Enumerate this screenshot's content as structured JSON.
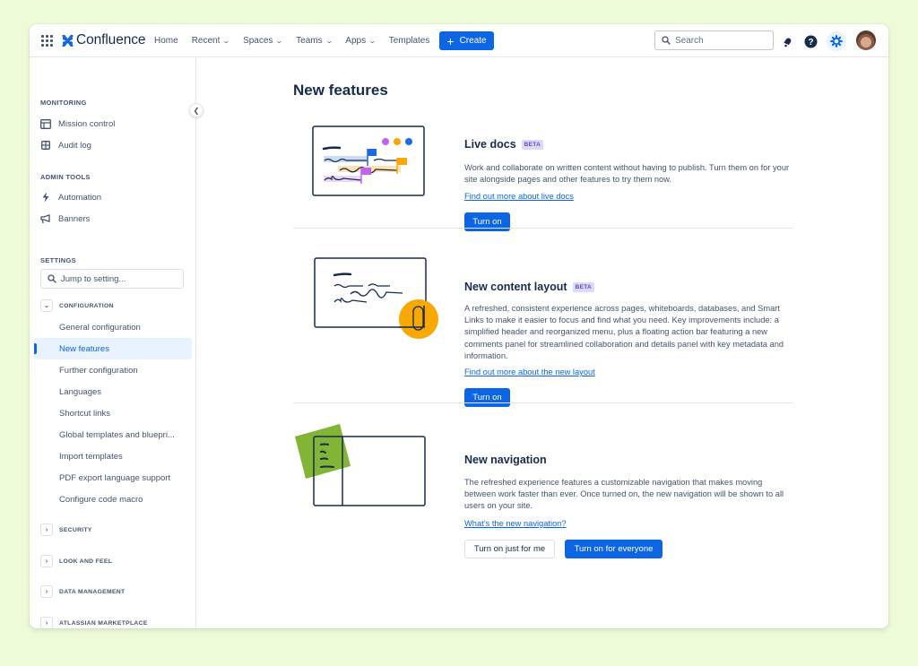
{
  "topnav": {
    "app_name": "Confluence",
    "items": [
      {
        "label": "Home",
        "dropdown": false
      },
      {
        "label": "Recent",
        "dropdown": true
      },
      {
        "label": "Spaces",
        "dropdown": true
      },
      {
        "label": "Teams",
        "dropdown": true
      },
      {
        "label": "Apps",
        "dropdown": true
      },
      {
        "label": "Templates",
        "dropdown": false
      }
    ],
    "create_label": "Create",
    "search_placeholder": "Search",
    "icons": [
      "notifications-icon",
      "help-icon",
      "settings-icon",
      "avatar"
    ]
  },
  "sidebar": {
    "monitoring": {
      "label": "MONITORING",
      "items": [
        {
          "label": "Mission control",
          "icon": "dashboard-icon"
        },
        {
          "label": "Audit log",
          "icon": "table-icon"
        }
      ]
    },
    "admin_tools": {
      "label": "ADMIN TOOLS",
      "items": [
        {
          "label": "Automation",
          "icon": "lightning-icon"
        },
        {
          "label": "Banners",
          "icon": "megaphone-icon"
        }
      ]
    },
    "settings": {
      "label": "SETTINGS",
      "search_placeholder": "Jump to setting...",
      "configuration": {
        "label": "CONFIGURATION",
        "expanded": true,
        "items": [
          {
            "label": "General configuration",
            "selected": false
          },
          {
            "label": "New features",
            "selected": true
          },
          {
            "label": "Further configuration",
            "selected": false
          },
          {
            "label": "Languages",
            "selected": false
          },
          {
            "label": "Shortcut links",
            "selected": false
          },
          {
            "label": "Global templates and bluepri...",
            "selected": false
          },
          {
            "label": "Import templates",
            "selected": false
          },
          {
            "label": "PDF export language support",
            "selected": false
          },
          {
            "label": "Configure code macro",
            "selected": false
          }
        ]
      },
      "collapsed_groups": [
        {
          "label": "SECURITY"
        },
        {
          "label": "LOOK AND FEEL"
        },
        {
          "label": "DATA MANAGEMENT"
        },
        {
          "label": "ATLASSIAN MARKETPLACE"
        }
      ]
    }
  },
  "main": {
    "title": "New features",
    "features": [
      {
        "title": "Live docs",
        "badge": "BETA",
        "description": "Work and collaborate on written content without having to publish. Turn them on for your site alongside pages and other features to try them now.",
        "link": "Find out more about live docs",
        "buttons": [
          {
            "label": "Turn on",
            "style": "primary"
          }
        ]
      },
      {
        "title": "New content layout",
        "badge": "BETA",
        "description": "A refreshed, consistent experience across pages, whiteboards, databases, and Smart Links to make it easier to focus and find what you need. Key improvements include: a simplified header and reorganized menu, plus a floating action bar featuring a new comments panel for streamlined collaboration and details panel with key metadata and information.",
        "link": "Find out more about the new layout",
        "buttons": [
          {
            "label": "Turn on",
            "style": "primary"
          }
        ]
      },
      {
        "title": "New navigation",
        "badge": "",
        "description": "The refreshed experience features a customizable navigation that makes moving between work faster than ever. Once turned on, the new navigation will be shown to all users on your site.",
        "link": "What’s the new navigation?",
        "buttons": [
          {
            "label": "Turn on just for me",
            "style": "secondary"
          },
          {
            "label": "Turn on for everyone",
            "style": "primary"
          }
        ]
      }
    ]
  },
  "colors": {
    "background": "#eefbd8",
    "brand_blue": "#0c66e4",
    "text_primary": "#172b4d",
    "text_subtle": "#44546f",
    "beta_bg": "#dfd8fd",
    "beta_text": "#5e4db2",
    "selected_bg": "#e9f2ff",
    "illus_purple": "#bf63f3",
    "illus_orange": "#f8a800",
    "illus_blue": "#1d6ae5",
    "illus_green": "#82b536"
  }
}
